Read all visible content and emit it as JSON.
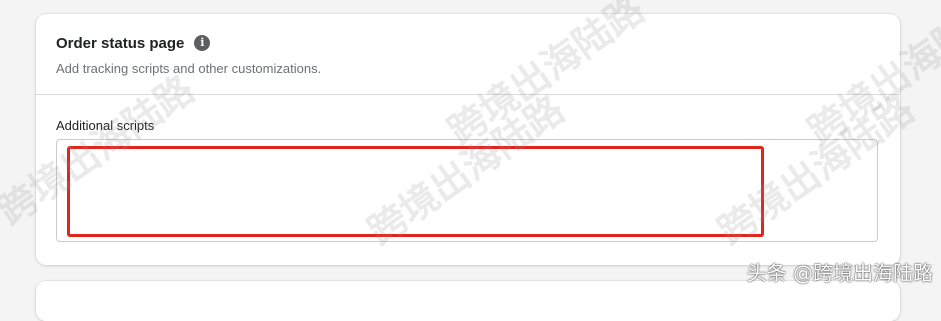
{
  "section": {
    "title": "Order status page",
    "info_icon": "info-icon",
    "subtitle": "Add tracking scripts and other customizations."
  },
  "field": {
    "label": "Additional scripts",
    "value": ""
  },
  "annotation": {
    "highlight_color": "#e2241e"
  },
  "watermark": {
    "text": "跨境出海陆路",
    "footer": "头条 @跨境出海陆路"
  }
}
